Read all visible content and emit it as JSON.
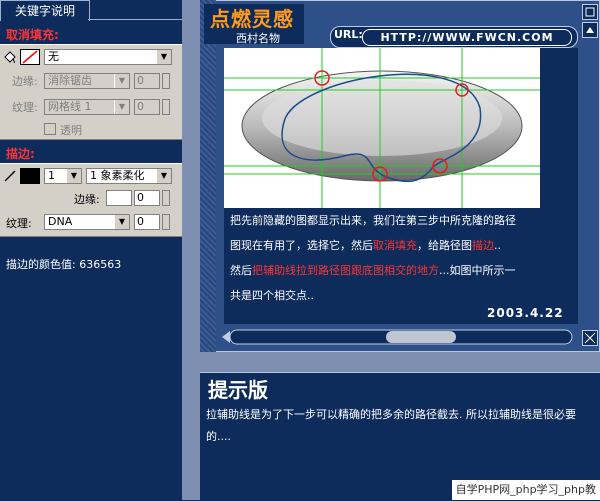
{
  "left_panel": {
    "tab_label": "关键字说明",
    "fill_section": {
      "title": "取消填充:",
      "fill_value": "无",
      "edge_label": "边缘:",
      "edge_value": "消除锯齿",
      "edge_spin": "0",
      "texture_label": "纹理:",
      "texture_value": "网格线 1",
      "texture_spin": "0",
      "transparent_label": "透明"
    },
    "stroke_section": {
      "title": "描边:",
      "size_value": "1",
      "stroke_type": "1 象素柔化",
      "edge_label": "边缘:",
      "edge_value": "",
      "edge_spin": "0",
      "texture_label": "纹理:",
      "texture_value": "DNA",
      "texture_spin": "0"
    },
    "stroke_color_text": "描边的颜色值:  636563"
  },
  "header": {
    "title": "点燃灵感",
    "subtitle": "西村名物",
    "url_label": "URL:",
    "url_value": "HTTP://WWW.FWCN.COM"
  },
  "article": {
    "line1": "把先前隐藏的图都显示出来，我们在第三步中所克隆的路径",
    "line2a": "图现在有用了，选择它，然后",
    "line2b": "取消填充",
    "line2c": "，给路径图",
    "line2d": "描边",
    "line2e": "..",
    "line3a": "然后",
    "line3b": "把辅助线拉到路径图跟底图相交的地方",
    "line3c": "...如图中所示一",
    "line4": "共是四个相交点..",
    "date": "2003.4.22"
  },
  "tip": {
    "title": "提示版",
    "text": "拉辅助线是为了下一步可以精确的把多余的路径截去.  所以拉辅助线是很必要的...."
  },
  "watermark": "自学PHP网_php学习_php教",
  "colors": {
    "accent": "#ff3333",
    "title": "#ff9a1a",
    "panel_bg": "#0d2c5c",
    "frame": "#2e5089"
  }
}
